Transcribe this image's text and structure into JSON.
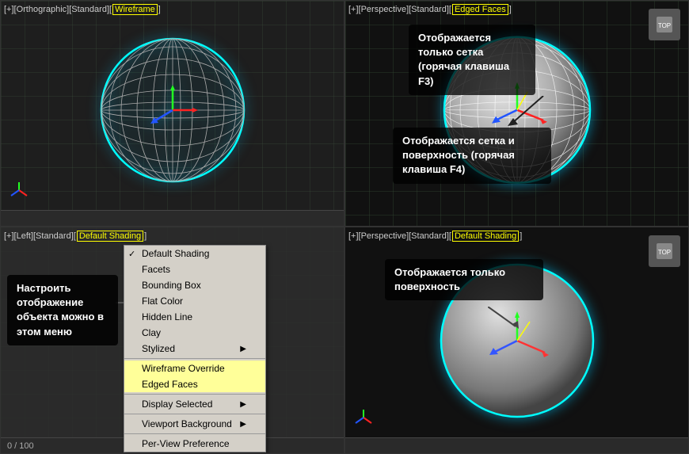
{
  "viewports": {
    "top_left": {
      "label": "[+][Orthographic][Standard][",
      "label_highlighted": "Wireframe",
      "label_end": "]",
      "type": "wireframe"
    },
    "top_right": {
      "label": "[+][Perspective][Standard][",
      "label_highlighted": "Edged Faces",
      "label_end": "]",
      "type": "edged_faces"
    },
    "bottom_left": {
      "label": "[+][Left][Standard][",
      "label_highlighted": "Default Shading",
      "label_end": "]",
      "type": "shading_menu"
    },
    "bottom_right": {
      "label": "[+][Perspective][Standard][",
      "label_highlighted": "Default Shading",
      "label_end": "]",
      "type": "default_shading"
    }
  },
  "callouts": {
    "top_center": "Отображается\nтолько сетка\n(горячая\nклавиша F3)",
    "middle_center": "Отображается сетка\nи поверхность\n(горячая клавиша F4)",
    "bottom_right_text": "Отображается\nтолько поверхность",
    "bottom_left_text": "Настроить\nотображение\nобъекта можно\nв этом меню"
  },
  "menu": {
    "items": [
      {
        "label": "Default Shading",
        "checked": true,
        "arrow": false,
        "highlighted": false
      },
      {
        "label": "Facets",
        "checked": false,
        "arrow": false,
        "highlighted": false
      },
      {
        "label": "Bounding Box",
        "checked": false,
        "arrow": false,
        "highlighted": false
      },
      {
        "label": "Flat Color",
        "checked": false,
        "arrow": false,
        "highlighted": false
      },
      {
        "label": "Hidden Line",
        "checked": false,
        "arrow": false,
        "highlighted": false
      },
      {
        "label": "Clay",
        "checked": false,
        "arrow": false,
        "highlighted": false
      },
      {
        "label": "Stylized",
        "checked": false,
        "arrow": true,
        "highlighted": false
      },
      {
        "separator": true
      },
      {
        "label": "Wireframe Override",
        "checked": false,
        "arrow": false,
        "highlighted": true
      },
      {
        "label": "Edged Faces",
        "checked": false,
        "arrow": false,
        "highlighted": true
      },
      {
        "separator": true
      },
      {
        "label": "Display Selected",
        "checked": false,
        "arrow": true,
        "highlighted": false
      },
      {
        "separator": true
      },
      {
        "label": "Viewport Background",
        "checked": false,
        "arrow": true,
        "highlighted": false
      },
      {
        "separator": true
      },
      {
        "label": "Per-View Preference",
        "checked": false,
        "arrow": false,
        "highlighted": false
      }
    ]
  },
  "status": {
    "value": "0 / 100"
  },
  "colors": {
    "cyan_border": "#00ffff",
    "yellow_highlight": "#ffff00",
    "menu_highlight": "#ffff99",
    "gizmo_red": "#ff2222",
    "gizmo_green": "#22ff22",
    "gizmo_blue": "#2255ff",
    "gizmo_yellow": "#ffff00"
  }
}
